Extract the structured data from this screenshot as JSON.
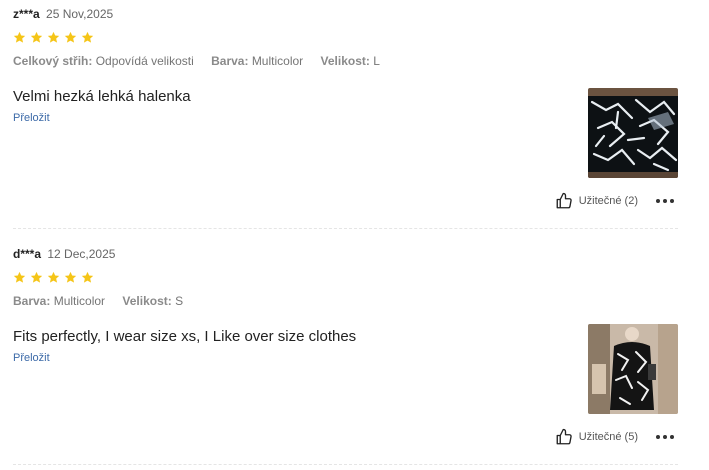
{
  "colors": {
    "star": "#f5c518",
    "link": "#3c6aa8"
  },
  "reviews": [
    {
      "user": "z***a",
      "date": "25 Nov,2025",
      "rating": 5,
      "attributes": [
        {
          "key": "Celkový střih:",
          "value": "Odpovídá velikosti"
        },
        {
          "key": "Barva:",
          "value": "Multicolor"
        },
        {
          "key": "Velikost:",
          "value": "L"
        }
      ],
      "text": "Velmi hezká lehká halenka",
      "translate_label": "Přeložit",
      "helpful_label": "Užitečné (2)"
    },
    {
      "user": "d***a",
      "date": "12 Dec,2025",
      "rating": 5,
      "attributes": [
        {
          "key": "Barva:",
          "value": "Multicolor"
        },
        {
          "key": "Velikost:",
          "value": "S"
        }
      ],
      "text": "Fits perfectly, I wear size xs, I Like over size clothes",
      "translate_label": "Přeložit",
      "helpful_label": "Užitečné (5)"
    }
  ]
}
